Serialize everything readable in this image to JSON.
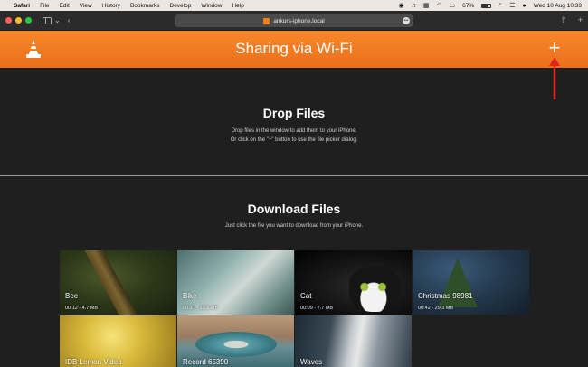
{
  "menubar": {
    "apple_icon": "apple-logo-icon",
    "items": [
      "Safari",
      "File",
      "Edit",
      "View",
      "History",
      "Bookmarks",
      "Develop",
      "Window",
      "Help"
    ],
    "battery_percent": "67%",
    "datetime": "Wed 10 Aug  10:33"
  },
  "browser": {
    "url": "ankurs-iphone.local",
    "more_icon": "ellipsis-icon"
  },
  "header": {
    "title": "Sharing via Wi-Fi",
    "plus_label": "+",
    "accent_color": "#f07f1b",
    "annotation_arrow_color": "#e0251c"
  },
  "drop": {
    "title": "Drop Files",
    "line1": "Drop files in the window to add them to your iPhone.",
    "line2": "Or click on the \"+\" button to use the file picker dialog."
  },
  "download": {
    "title": "Download Files",
    "subtitle": "Just click the file you want to download from your iPhone.",
    "files": [
      {
        "name": "Bee",
        "meta": "00:12 - 4.7 MB"
      },
      {
        "name": "Bike",
        "meta": "00:31 - 12.2 MB"
      },
      {
        "name": "Cat",
        "meta": "00:09 - 7.7 MB"
      },
      {
        "name": "Christmas 98981",
        "meta": "00:42 - 29.3 MB"
      },
      {
        "name": "IDB Lemon Video",
        "meta": ""
      },
      {
        "name": "Record 65390",
        "meta": ""
      },
      {
        "name": "Waves",
        "meta": ""
      }
    ]
  }
}
